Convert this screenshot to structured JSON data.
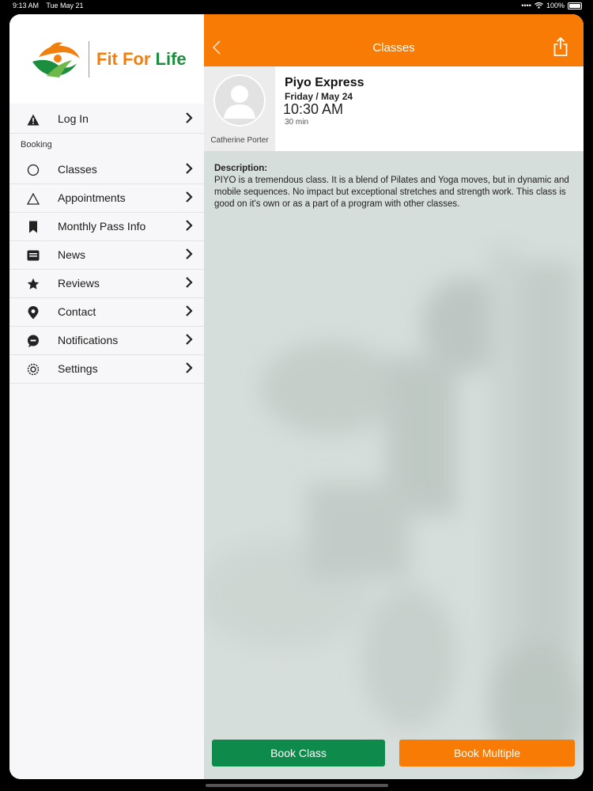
{
  "status_bar": {
    "time": "9:13 AM",
    "date": "Tue May 21",
    "battery": "100%"
  },
  "sidebar": {
    "logo_text_1": "Fit For ",
    "logo_text_2": "Life",
    "login": {
      "label": "Log In",
      "icon": "warning-icon"
    },
    "section_label": "Booking",
    "items": [
      {
        "label": "Classes",
        "icon": "circle-icon"
      },
      {
        "label": "Appointments",
        "icon": "triangle-icon"
      },
      {
        "label": "Monthly Pass Info",
        "icon": "bookmark-icon"
      },
      {
        "label": "News",
        "icon": "news-icon"
      },
      {
        "label": "Reviews",
        "icon": "star-icon"
      },
      {
        "label": "Contact",
        "icon": "location-pin-icon"
      },
      {
        "label": "Notifications",
        "icon": "chat-bubble-icon"
      },
      {
        "label": "Settings",
        "icon": "gear-icon"
      }
    ]
  },
  "main": {
    "nav_title": "Classes",
    "class": {
      "name": "Piyo Express",
      "date": "Friday / May 24",
      "time": "10:30 AM",
      "duration": "30 min",
      "instructor": "Catherine Porter"
    },
    "description_title": "Description:",
    "description": "PIYO is a tremendous class. It is a blend of Pilates and Yoga moves, but in dynamic and mobile sequences. No impact but exceptional stretches and strength work. This class is good on it's own or as a part of a program with other classes.",
    "buttons": {
      "book": "Book Class",
      "multiple": "Book Multiple"
    }
  },
  "colors": {
    "accent_orange": "#f77b04",
    "accent_green": "#0e8a4a"
  }
}
